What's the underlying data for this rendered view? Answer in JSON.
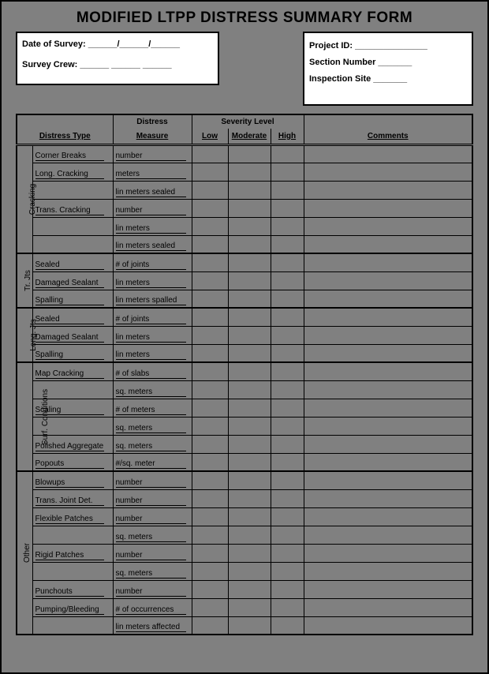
{
  "title": "MODIFIED LTPP DISTRESS SUMMARY FORM",
  "header_left": {
    "date_label": "Date of Survey: ______/______/______",
    "crew_label": "Survey Crew: ______  ______  ______"
  },
  "header_right": {
    "project_label": "Project ID:  _______________",
    "section_label": "Section Number _______",
    "site_label": "Inspection Site _______"
  },
  "columns": {
    "distress_type": "Distress Type",
    "distress_measure_top": "Distress",
    "distress_measure_bot": "Measure",
    "severity_group": "Severity Level",
    "low": "Low",
    "moderate": "Moderate",
    "high": "High",
    "comments": "Comments"
  },
  "groups": [
    {
      "category": "Cracking",
      "rows": [
        {
          "type": "Corner Breaks",
          "measure": "number"
        },
        {
          "type": "Long. Cracking",
          "measure": "meters"
        },
        {
          "type": "",
          "measure": "lin meters sealed"
        },
        {
          "type": "Trans. Cracking",
          "measure": "number"
        },
        {
          "type": "",
          "measure": "lin meters"
        },
        {
          "type": "",
          "measure": "lin meters sealed"
        }
      ]
    },
    {
      "category": "Tr. Jts",
      "rows": [
        {
          "type": "Sealed",
          "measure": "# of joints"
        },
        {
          "type": "Damaged Sealant",
          "measure": "lin meters"
        },
        {
          "type": "Spalling",
          "measure": "lin meters spalled"
        }
      ]
    },
    {
      "category": "Long. Jts",
      "rows": [
        {
          "type": "Sealed",
          "measure": "# of joints"
        },
        {
          "type": "Damaged Sealant",
          "measure": "lin meters"
        },
        {
          "type": "Spalling",
          "measure": "lin meters"
        }
      ]
    },
    {
      "category": "Surf. Conditions",
      "rows": [
        {
          "type": "Map Cracking",
          "measure": "# of slabs"
        },
        {
          "type": "",
          "measure": "sq. meters"
        },
        {
          "type": "Scaling",
          "measure": "# of meters"
        },
        {
          "type": "",
          "measure": "sq. meters"
        },
        {
          "type": "Polished Aggregate",
          "measure": "sq. meters"
        },
        {
          "type": "Popouts",
          "measure": "#/sq. meter"
        }
      ]
    },
    {
      "category": "Other",
      "rows": [
        {
          "type": "Blowups",
          "measure": "number"
        },
        {
          "type": "Trans. Joint Det.",
          "measure": "number"
        },
        {
          "type": "Flexible Patches",
          "measure": "number"
        },
        {
          "type": "",
          "measure": "sq. meters"
        },
        {
          "type": "Rigid Patches",
          "measure": "number"
        },
        {
          "type": "",
          "measure": "sq. meters"
        },
        {
          "type": "Punchouts",
          "measure": "number"
        },
        {
          "type": "Pumping/Bleeding",
          "measure": "# of occurrences"
        },
        {
          "type": "",
          "measure": "lin meters affected"
        }
      ]
    }
  ]
}
